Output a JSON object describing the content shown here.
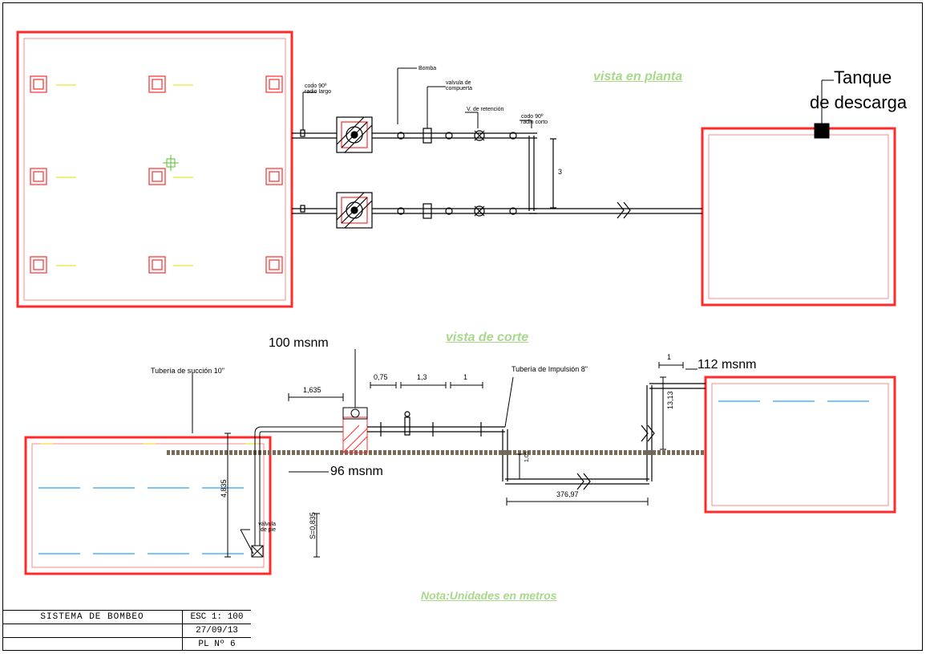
{
  "title_block": {
    "title": "SISTEMA DE BOMBEO",
    "scale": "ESC 1: 100",
    "date": "27/09/13",
    "sheet": "PL Nº 6"
  },
  "views": {
    "plan": "vista en planta",
    "section": "vista de corte"
  },
  "note": "Nota:Unidades en metros",
  "labels": {
    "tanque_descarga1": "Tanque",
    "tanque_descarga2": "de descarga",
    "codo_90_radio_largo": "codo 90º\nradio largo",
    "bomba": "Bomba",
    "valvula_compuerta": "valvula de\ncompuerta",
    "v_retencion": "V. de retención",
    "codo_90_radio_corto": "codo 90º\nradio corto",
    "tuberia_succion": "Tubería de succión 10\"",
    "tuberia_impulsion": "Tubería de Impulsión 8\"",
    "valvula_pie": "válvula\nde pie",
    "lvl_100": "100 msnm",
    "lvl_96": "96 msnm",
    "lvl_112": "112 msnm"
  },
  "dims": {
    "d_1635": "1,635",
    "d_075": "0,75",
    "d_13": "1,3",
    "d_1": "1",
    "d_3": "3",
    "d_4835": "4,835",
    "d_s0835": "S=0,835",
    "d_37697": "376,97",
    "d_1313": "13,13",
    "d_105": "1,05",
    "d_1b": "1"
  }
}
